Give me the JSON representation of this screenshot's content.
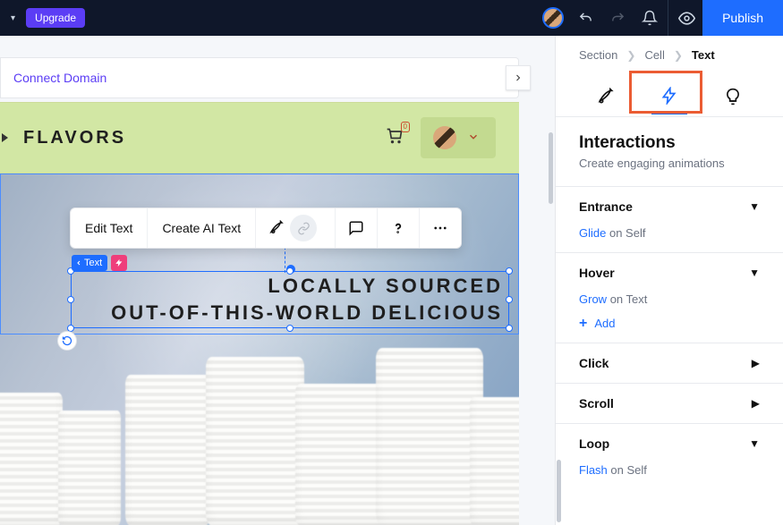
{
  "topbar": {
    "upgrade_label": "Upgrade",
    "publish_label": "Publish"
  },
  "domain_bar": {
    "link_text": "Connect Domain"
  },
  "site": {
    "title": "FLAVORS",
    "cart_count": "0",
    "hero_line1": "LOCALLY SOURCED",
    "hero_line2": "OUT-OF-THIS-WORLD DELICIOUS"
  },
  "toolbar": {
    "edit_text": "Edit Text",
    "create_ai": "Create AI Text"
  },
  "selection": {
    "tag_label": "Text"
  },
  "breadcrumb": {
    "l1": "Section",
    "l2": "Cell",
    "l3": "Text"
  },
  "panel": {
    "title": "Interactions",
    "subtitle": "Create engaging animations",
    "add_label": "Add",
    "items": [
      {
        "label": "Entrance",
        "anim": "Glide",
        "target": "on Self",
        "expanded": true,
        "arrow": "▼"
      },
      {
        "label": "Hover",
        "anim": "Grow",
        "target": "on Text",
        "expanded": true,
        "arrow": "▼",
        "show_add": true
      },
      {
        "label": "Click",
        "expanded": false,
        "arrow": "▶"
      },
      {
        "label": "Scroll",
        "expanded": false,
        "arrow": "▶"
      },
      {
        "label": "Loop",
        "anim": "Flash",
        "target": "on Self",
        "expanded": true,
        "arrow": "▼"
      }
    ]
  }
}
